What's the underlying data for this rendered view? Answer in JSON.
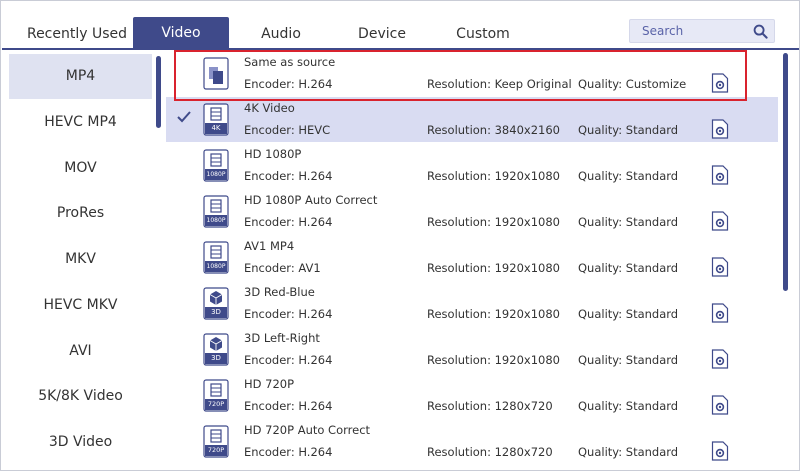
{
  "tabs": [
    {
      "label": "Recently Used"
    },
    {
      "label": "Video"
    },
    {
      "label": "Audio"
    },
    {
      "label": "Device"
    },
    {
      "label": "Custom"
    }
  ],
  "search": {
    "placeholder": "Search"
  },
  "categories": [
    {
      "label": "MP4"
    },
    {
      "label": "HEVC MP4"
    },
    {
      "label": "MOV"
    },
    {
      "label": "ProRes"
    },
    {
      "label": "MKV"
    },
    {
      "label": "HEVC MKV"
    },
    {
      "label": "AVI"
    },
    {
      "label": "5K/8K Video"
    },
    {
      "label": "3D Video"
    }
  ],
  "presets": [
    {
      "name": "Same as source",
      "encoder": "Encoder: H.264",
      "resolution": "Resolution: Keep Original",
      "quality": "Quality: Customize",
      "badge": ""
    },
    {
      "name": "4K Video",
      "encoder": "Encoder: HEVC",
      "resolution": "Resolution: 3840x2160",
      "quality": "Quality: Standard",
      "badge": "4K"
    },
    {
      "name": "HD 1080P",
      "encoder": "Encoder: H.264",
      "resolution": "Resolution: 1920x1080",
      "quality": "Quality: Standard",
      "badge": "1080P"
    },
    {
      "name": "HD 1080P Auto Correct",
      "encoder": "Encoder: H.264",
      "resolution": "Resolution: 1920x1080",
      "quality": "Quality: Standard",
      "badge": "1080P"
    },
    {
      "name": "AV1 MP4",
      "encoder": "Encoder: AV1",
      "resolution": "Resolution: 1920x1080",
      "quality": "Quality: Standard",
      "badge": "1080P"
    },
    {
      "name": "3D Red-Blue",
      "encoder": "Encoder: H.264",
      "resolution": "Resolution: 1920x1080",
      "quality": "Quality: Standard",
      "badge": "3D"
    },
    {
      "name": "3D Left-Right",
      "encoder": "Encoder: H.264",
      "resolution": "Resolution: 1920x1080",
      "quality": "Quality: Standard",
      "badge": "3D"
    },
    {
      "name": "HD 720P",
      "encoder": "Encoder: H.264",
      "resolution": "Resolution: 1280x720",
      "quality": "Quality: Standard",
      "badge": "720P"
    },
    {
      "name": "HD 720P Auto Correct",
      "encoder": "Encoder: H.264",
      "resolution": "Resolution: 1280x720",
      "quality": "Quality: Standard",
      "badge": "720P"
    }
  ],
  "colors": {
    "accent": "#3f4a8a",
    "selected_row": "#d9dcf2",
    "highlight": "#d9232e"
  }
}
